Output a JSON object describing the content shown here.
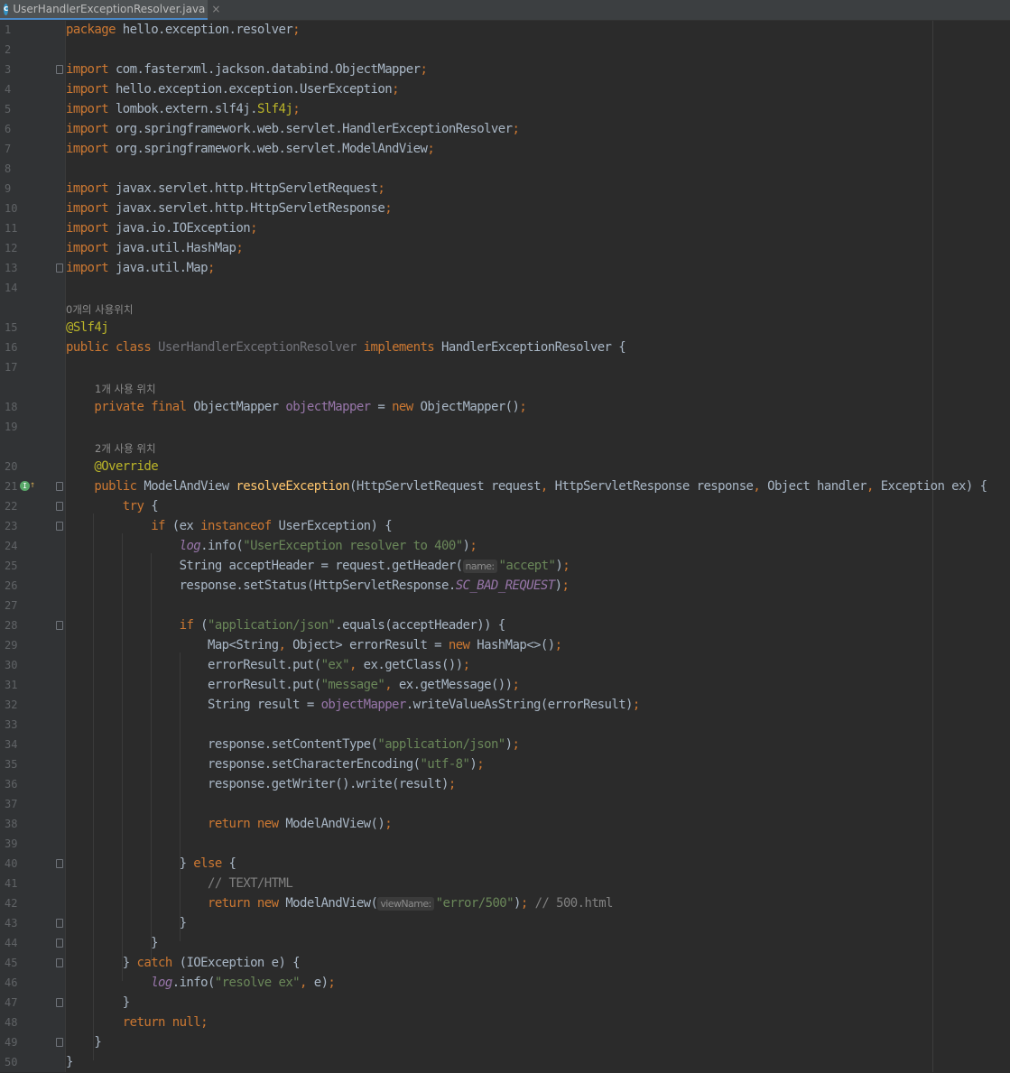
{
  "tab": {
    "filename": "UserHandlerExceptionResolver.java",
    "icon": "java-class-icon",
    "close_symbol": "×"
  },
  "inline_hints": {
    "h15": "0개의 사용위치",
    "h18": "1개 사용 위치",
    "h20": "2개 사용 위치",
    "param_name": "name:",
    "param_viewName": "viewName:"
  },
  "lines": [
    {
      "n": "1",
      "segs": [
        [
          "kw",
          "package "
        ],
        [
          "cls",
          "hello.exception.resolver"
        ],
        [
          "kw",
          ";"
        ]
      ]
    },
    {
      "n": "2",
      "segs": []
    },
    {
      "n": "3",
      "segs": [
        [
          "kw",
          "import "
        ],
        [
          "cls",
          "com.fasterxml.jackson.databind.ObjectMapper"
        ],
        [
          "kw",
          ";"
        ]
      ]
    },
    {
      "n": "4",
      "segs": [
        [
          "kw",
          "import "
        ],
        [
          "cls",
          "hello.exception.exception.UserException"
        ],
        [
          "kw",
          ";"
        ]
      ]
    },
    {
      "n": "5",
      "segs": [
        [
          "kw",
          "import "
        ],
        [
          "cls",
          "lombok.extern.slf4j."
        ],
        [
          "ann",
          "Slf4j"
        ],
        [
          "kw",
          ";"
        ]
      ]
    },
    {
      "n": "6",
      "segs": [
        [
          "kw",
          "import "
        ],
        [
          "cls",
          "org.springframework.web.servlet.HandlerExceptionResolver"
        ],
        [
          "kw",
          ";"
        ]
      ]
    },
    {
      "n": "7",
      "segs": [
        [
          "kw",
          "import "
        ],
        [
          "cls",
          "org.springframework.web.servlet.ModelAndView"
        ],
        [
          "kw",
          ";"
        ]
      ]
    },
    {
      "n": "8",
      "segs": []
    },
    {
      "n": "9",
      "segs": [
        [
          "kw",
          "import "
        ],
        [
          "cls",
          "javax.servlet.http.HttpServletRequest"
        ],
        [
          "kw",
          ";"
        ]
      ]
    },
    {
      "n": "10",
      "segs": [
        [
          "kw",
          "import "
        ],
        [
          "cls",
          "javax.servlet.http.HttpServletResponse"
        ],
        [
          "kw",
          ";"
        ]
      ]
    },
    {
      "n": "11",
      "segs": [
        [
          "kw",
          "import "
        ],
        [
          "cls",
          "java.io.IOException"
        ],
        [
          "kw",
          ";"
        ]
      ]
    },
    {
      "n": "12",
      "segs": [
        [
          "kw",
          "import "
        ],
        [
          "cls",
          "java.util.HashMap"
        ],
        [
          "kw",
          ";"
        ]
      ]
    },
    {
      "n": "13",
      "segs": [
        [
          "kw",
          "import "
        ],
        [
          "cls",
          "java.util.Map"
        ],
        [
          "kw",
          ";"
        ]
      ]
    },
    {
      "n": "14",
      "segs": []
    },
    {
      "n": "15",
      "segs": [
        [
          "ann",
          "@Slf4j"
        ]
      ]
    },
    {
      "n": "16",
      "segs": [
        [
          "kw",
          "public class "
        ],
        [
          "gray",
          "UserHandlerExceptionResolver "
        ],
        [
          "kw",
          "implements "
        ],
        [
          "cls",
          "HandlerExceptionResolver {"
        ]
      ]
    },
    {
      "n": "17",
      "segs": []
    },
    {
      "n": "18",
      "segs": [
        [
          "cls",
          "    "
        ],
        [
          "kw",
          "private final "
        ],
        [
          "cls",
          "ObjectMapper "
        ],
        [
          "fld",
          "objectMapper"
        ],
        [
          "cls",
          " = "
        ],
        [
          "kw",
          "new "
        ],
        [
          "cls",
          "ObjectMapper()"
        ],
        [
          "kw",
          ";"
        ]
      ]
    },
    {
      "n": "19",
      "segs": []
    },
    {
      "n": "20",
      "segs": [
        [
          "cls",
          "    "
        ],
        [
          "ann",
          "@Override"
        ]
      ]
    },
    {
      "n": "21",
      "segs": [
        [
          "cls",
          "    "
        ],
        [
          "kw",
          "public "
        ],
        [
          "cls",
          "ModelAndView "
        ],
        [
          "fn",
          "resolveException"
        ],
        [
          "cls",
          "(HttpServletRequest request"
        ],
        [
          "kw",
          ", "
        ],
        [
          "cls",
          "HttpServletResponse response"
        ],
        [
          "kw",
          ", "
        ],
        [
          "cls",
          "Object handler"
        ],
        [
          "kw",
          ", "
        ],
        [
          "cls",
          "Exception ex) {"
        ]
      ]
    },
    {
      "n": "22",
      "segs": [
        [
          "cls",
          "        "
        ],
        [
          "kw",
          "try "
        ],
        [
          "cls",
          "{"
        ]
      ]
    },
    {
      "n": "23",
      "segs": [
        [
          "cls",
          "            "
        ],
        [
          "kw",
          "if "
        ],
        [
          "cls",
          "(ex "
        ],
        [
          "kw",
          "instanceof "
        ],
        [
          "cls",
          "UserException) {"
        ]
      ]
    },
    {
      "n": "24",
      "segs": [
        [
          "cls",
          "                "
        ],
        [
          "fld it",
          "log"
        ],
        [
          "cls",
          ".info("
        ],
        [
          "str",
          "\"UserException resolver to 400\""
        ],
        [
          "cls",
          ")"
        ],
        [
          "kw",
          ";"
        ]
      ]
    },
    {
      "n": "25",
      "segs": [
        [
          "cls",
          "                String acceptHeader = request.getHeader("
        ],
        [
          "hint_name",
          ""
        ],
        [
          "str",
          "\"accept\""
        ],
        [
          "cls",
          ")"
        ],
        [
          "kw",
          ";"
        ]
      ]
    },
    {
      "n": "26",
      "segs": [
        [
          "cls",
          "                response.setStatus(HttpServletResponse."
        ],
        [
          "fld it",
          "SC_BAD_REQUEST"
        ],
        [
          "cls",
          ")"
        ],
        [
          "kw",
          ";"
        ]
      ]
    },
    {
      "n": "27",
      "segs": []
    },
    {
      "n": "28",
      "segs": [
        [
          "cls",
          "                "
        ],
        [
          "kw",
          "if "
        ],
        [
          "cls",
          "("
        ],
        [
          "str",
          "\"application/json\""
        ],
        [
          "cls",
          ".equals(acceptHeader)) {"
        ]
      ]
    },
    {
      "n": "29",
      "segs": [
        [
          "cls",
          "                    Map<String"
        ],
        [
          "kw",
          ", "
        ],
        [
          "cls",
          "Object> errorResult = "
        ],
        [
          "kw",
          "new "
        ],
        [
          "cls",
          "HashMap<>()"
        ],
        [
          "kw",
          ";"
        ]
      ]
    },
    {
      "n": "30",
      "segs": [
        [
          "cls",
          "                    errorResult.put("
        ],
        [
          "str",
          "\"ex\""
        ],
        [
          "kw",
          ", "
        ],
        [
          "cls",
          "ex.getClass())"
        ],
        [
          "kw",
          ";"
        ]
      ]
    },
    {
      "n": "31",
      "segs": [
        [
          "cls",
          "                    errorResult.put("
        ],
        [
          "str",
          "\"message\""
        ],
        [
          "kw",
          ", "
        ],
        [
          "cls",
          "ex.getMessage())"
        ],
        [
          "kw",
          ";"
        ]
      ]
    },
    {
      "n": "32",
      "segs": [
        [
          "cls",
          "                    String result = "
        ],
        [
          "fld",
          "objectMapper"
        ],
        [
          "cls",
          ".writeValueAsString(errorResult)"
        ],
        [
          "kw",
          ";"
        ]
      ]
    },
    {
      "n": "33",
      "segs": []
    },
    {
      "n": "34",
      "segs": [
        [
          "cls",
          "                    response.setContentType("
        ],
        [
          "str",
          "\"application/json\""
        ],
        [
          "cls",
          ")"
        ],
        [
          "kw",
          ";"
        ]
      ]
    },
    {
      "n": "35",
      "segs": [
        [
          "cls",
          "                    response.setCharacterEncoding("
        ],
        [
          "str",
          "\"utf-8\""
        ],
        [
          "cls",
          ")"
        ],
        [
          "kw",
          ";"
        ]
      ]
    },
    {
      "n": "36",
      "segs": [
        [
          "cls",
          "                    response.getWriter().write(result)"
        ],
        [
          "kw",
          ";"
        ]
      ]
    },
    {
      "n": "37",
      "segs": []
    },
    {
      "n": "38",
      "segs": [
        [
          "cls",
          "                    "
        ],
        [
          "kw",
          "return new "
        ],
        [
          "cls",
          "ModelAndView()"
        ],
        [
          "kw",
          ";"
        ]
      ]
    },
    {
      "n": "39",
      "segs": []
    },
    {
      "n": "40",
      "segs": [
        [
          "cls",
          "                } "
        ],
        [
          "kw",
          "else "
        ],
        [
          "cls",
          "{"
        ]
      ]
    },
    {
      "n": "41",
      "segs": [
        [
          "cls",
          "                    "
        ],
        [
          "cmt",
          "// TEXT/HTML"
        ]
      ]
    },
    {
      "n": "42",
      "segs": [
        [
          "cls",
          "                    "
        ],
        [
          "kw",
          "return new "
        ],
        [
          "cls",
          "ModelAndView("
        ],
        [
          "hint_viewName",
          ""
        ],
        [
          "str",
          "\"error/500\""
        ],
        [
          "cls",
          ")"
        ],
        [
          "kw",
          "; "
        ],
        [
          "cmt",
          "// 500.html"
        ]
      ]
    },
    {
      "n": "43",
      "segs": [
        [
          "cls",
          "                }"
        ]
      ]
    },
    {
      "n": "44",
      "segs": [
        [
          "cls",
          "            }"
        ]
      ]
    },
    {
      "n": "45",
      "segs": [
        [
          "cls",
          "        } "
        ],
        [
          "kw",
          "catch "
        ],
        [
          "cls",
          "(IOException e) {"
        ]
      ]
    },
    {
      "n": "46",
      "segs": [
        [
          "cls",
          "            "
        ],
        [
          "fld it",
          "log"
        ],
        [
          "cls",
          ".info("
        ],
        [
          "str",
          "\"resolve ex\""
        ],
        [
          "kw",
          ", "
        ],
        [
          "cls",
          "e)"
        ],
        [
          "kw",
          ";"
        ]
      ]
    },
    {
      "n": "47",
      "segs": [
        [
          "cls",
          "        }"
        ]
      ]
    },
    {
      "n": "48",
      "segs": [
        [
          "cls",
          "        "
        ],
        [
          "kw",
          "return null;"
        ]
      ]
    },
    {
      "n": "49",
      "segs": [
        [
          "cls",
          "    }"
        ]
      ]
    },
    {
      "n": "50",
      "segs": [
        [
          "cls",
          "}"
        ]
      ]
    }
  ]
}
